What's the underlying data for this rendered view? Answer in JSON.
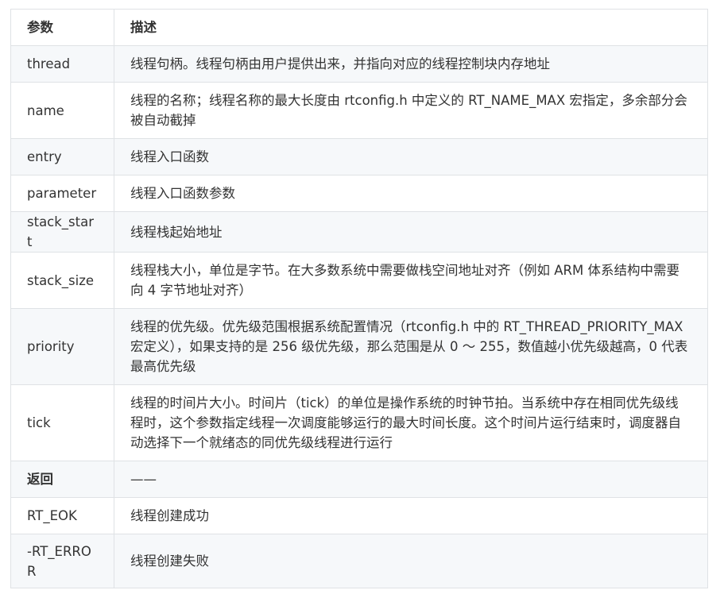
{
  "table": {
    "headers": [
      "参数",
      "描述"
    ],
    "rows": [
      {
        "param": "thread",
        "desc": "线程句柄。线程句柄由用户提供出来，并指向对应的线程控制块内存地址"
      },
      {
        "param": "name",
        "desc": "线程的名称；线程名称的最大长度由 rtconfig.h 中定义的 RT_NAME_MAX 宏指定，多余部分会被自动截掉"
      },
      {
        "param": "entry",
        "desc": "线程入口函数"
      },
      {
        "param": "parameter",
        "desc": "线程入口函数参数"
      },
      {
        "param": "stack_start",
        "desc": "线程栈起始地址"
      },
      {
        "param": "stack_size",
        "desc": "线程栈大小，单位是字节。在大多数系统中需要做栈空间地址对齐（例如 ARM 体系结构中需要向 4 字节地址对齐）"
      },
      {
        "param": "priority",
        "desc": "线程的优先级。优先级范围根据系统配置情况（rtconfig.h 中的 RT_THREAD_PRIORITY_MAX 宏定义），如果支持的是 256 级优先级，那么范围是从 0 ～ 255，数值越小优先级越高，0 代表最高优先级"
      },
      {
        "param": "tick",
        "desc": "线程的时间片大小。时间片（tick）的单位是操作系统的时钟节拍。当系统中存在相同优先级线程时，这个参数指定线程一次调度能够运行的最大时间长度。这个时间片运行结束时，调度器自动选择下一个就绪态的同优先级线程进行运行"
      },
      {
        "param": "返回",
        "desc": "——"
      },
      {
        "param": "RT_EOK",
        "desc": "线程创建成功"
      },
      {
        "param": "-RT_ERROR",
        "desc": "线程创建失败"
      }
    ]
  }
}
